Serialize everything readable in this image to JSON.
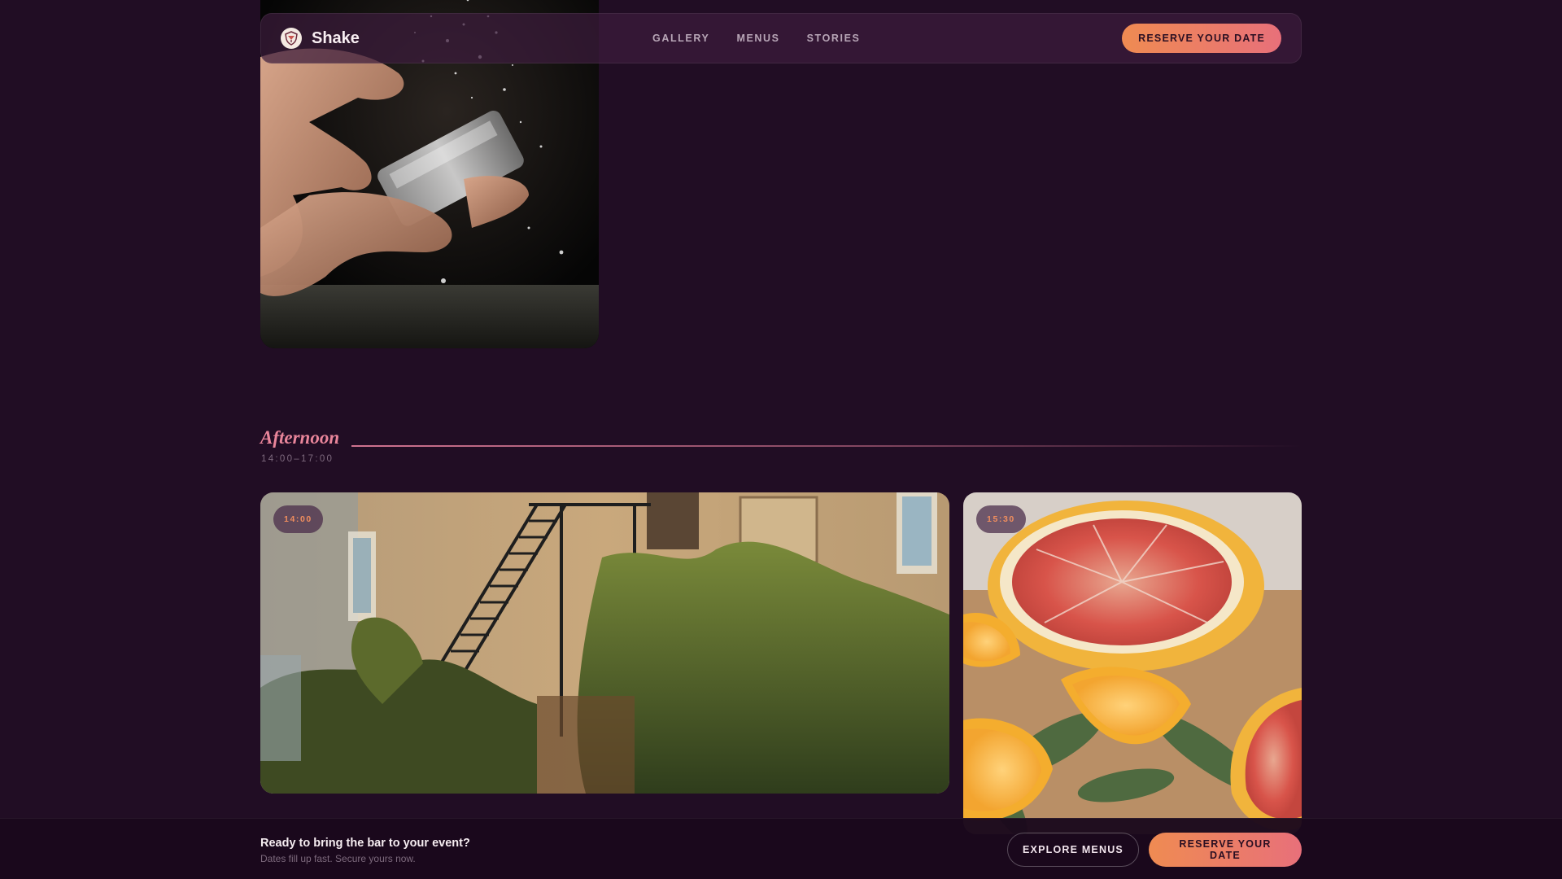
{
  "brand": {
    "name": "Shake",
    "logo_icon": "shield-cocktail-icon"
  },
  "nav": {
    "links": [
      "GALLERY",
      "MENUS",
      "STORIES"
    ],
    "cta_label": "RESERVE YOUR DATE"
  },
  "section": {
    "title": "Afternoon",
    "time_range": "14:00–17:00"
  },
  "cards": [
    {
      "time": "14:00",
      "image": "ivy-covered building with fire escape"
    },
    {
      "time": "15:30",
      "image": "halved grapefruits and oranges with mint"
    }
  ],
  "top_photo": {
    "image": "hands shaking a cocktail shaker with ice splashing"
  },
  "bottom_bar": {
    "title": "Ready to bring the bar to your event?",
    "subtitle": "Dates fill up fast. Secure yours now.",
    "secondary_label": "EXPLORE MENUS",
    "primary_label": "RESERVE YOUR DATE"
  },
  "colors": {
    "background": "#210d24",
    "accent_orange": "#ef8b52",
    "accent_pink": "#e8707a",
    "section_title": "#e9859a"
  }
}
